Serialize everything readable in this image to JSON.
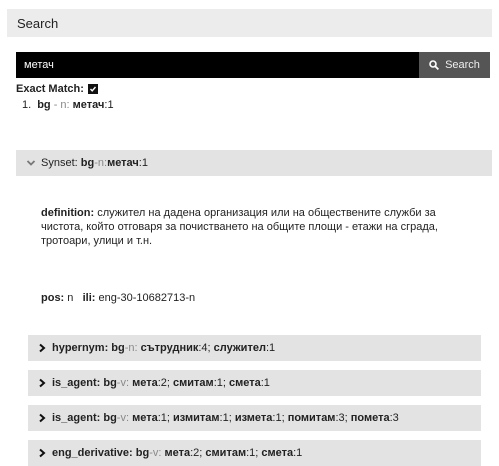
{
  "header": {
    "title": "Search"
  },
  "search": {
    "value": "метач",
    "button_label": "Search"
  },
  "exact_match": {
    "label": "Exact Match:",
    "checked": true
  },
  "results": [
    {
      "index": "1.",
      "lang": "bg",
      "sep": " - ",
      "pos": "n",
      "lemma": "метач",
      "count": ":1"
    }
  ],
  "synset": {
    "label": "Synset:",
    "lang": "bg",
    "sep": " - ",
    "pos": "n",
    "lemma": "метач",
    "count": ":1",
    "definition_label": "definition:",
    "definition_text": "служител на дадена организация или на обществените служби за чистота, който отговаря за почистването на общите площи - етажи на сграда, тротоари, улици и т.н.",
    "pos_label": "pos:",
    "pos_value": "n",
    "ili_label": "ili:",
    "ili_value": "eng-30-10682713-n"
  },
  "relations": [
    {
      "type": "hypernym",
      "lang": "bg",
      "pos": "n",
      "words": [
        {
          "w": "сътрудник",
          "c": ":4"
        },
        {
          "w": "служител",
          "c": ":1"
        }
      ]
    },
    {
      "type": "is_agent",
      "lang": "bg",
      "pos": "v",
      "words": [
        {
          "w": "мета",
          "c": ":2"
        },
        {
          "w": "смитам",
          "c": ":1"
        },
        {
          "w": "смета",
          "c": ":1"
        }
      ]
    },
    {
      "type": "is_agent",
      "lang": "bg",
      "pos": "v",
      "words": [
        {
          "w": "мета",
          "c": ":1"
        },
        {
          "w": "измитам",
          "c": ":1"
        },
        {
          "w": "измета",
          "c": ":1"
        },
        {
          "w": "помитам",
          "c": ":3"
        },
        {
          "w": "помета",
          "c": ":3"
        }
      ]
    },
    {
      "type": "eng_derivative",
      "lang": "bg",
      "pos": "v",
      "words": [
        {
          "w": "мета",
          "c": ":2"
        },
        {
          "w": "смитам",
          "c": ":1"
        },
        {
          "w": "смета",
          "c": ":1"
        }
      ]
    }
  ]
}
